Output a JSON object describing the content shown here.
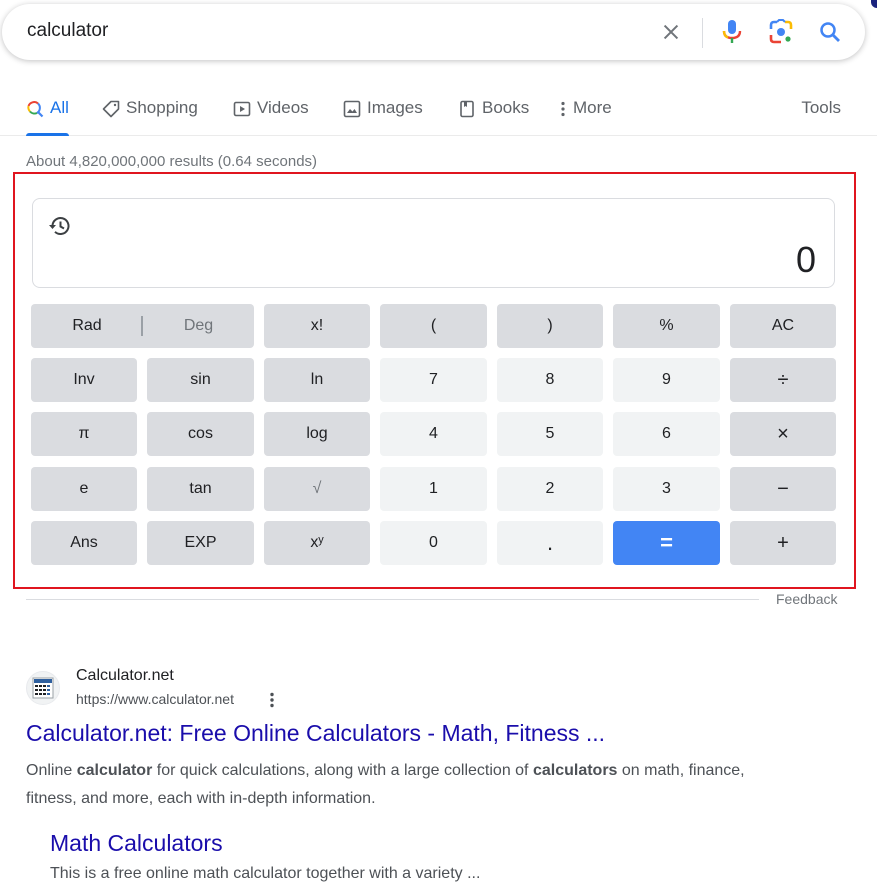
{
  "search": {
    "query": "calculator",
    "icons": [
      "clear-icon",
      "microphone-icon",
      "google-lens-icon",
      "search-icon"
    ]
  },
  "tabs": [
    {
      "label": "All",
      "icon": "search-icon",
      "active": true
    },
    {
      "label": "Shopping",
      "icon": "tag-icon",
      "active": false
    },
    {
      "label": "Videos",
      "icon": "play-icon",
      "active": false
    },
    {
      "label": "Images",
      "icon": "image-icon",
      "active": false
    },
    {
      "label": "Books",
      "icon": "book-icon",
      "active": false
    },
    {
      "label": "More",
      "icon": "more-vert-icon",
      "active": false
    }
  ],
  "tools_label": "Tools",
  "result_stats": "About 4,820,000,000 results (0.64 seconds)",
  "calculator": {
    "display": "0",
    "history_icon": "history-icon",
    "angle_mode": {
      "rad": "Rad",
      "deg": "Deg",
      "selected": "Rad"
    },
    "rows": [
      [
        "x!",
        "(",
        ")",
        "%",
        "AC"
      ],
      [
        "Inv",
        "sin",
        "ln",
        "7",
        "8",
        "9",
        "÷"
      ],
      [
        "π",
        "cos",
        "log",
        "4",
        "5",
        "6",
        "×"
      ],
      [
        "e",
        "tan",
        "√",
        "1",
        "2",
        "3",
        "−"
      ],
      [
        "Ans",
        "EXP",
        "xʸ",
        "0",
        ".",
        "=",
        "+"
      ]
    ],
    "accent_color": "#4285f4"
  },
  "feedback_label": "Feedback",
  "results": [
    {
      "site_name": "Calculator.net",
      "url": "https://www.calculator.net",
      "title": "Calculator.net: Free Online Calculators - Math, Fitness ...",
      "snippet_parts": [
        "Online ",
        "calculator",
        " for quick calculations, along with a large collection of ",
        "calculators",
        " on math, finance, fitness, and more, each with in-depth information."
      ],
      "sitelinks": [
        {
          "title": "Math Calculators",
          "description": "This is a free online math calculator together with a variety ..."
        }
      ]
    }
  ],
  "colors": {
    "link": "#1a0dab",
    "active_tab": "#1a73e8",
    "highlight_frame": "#e0151f"
  }
}
